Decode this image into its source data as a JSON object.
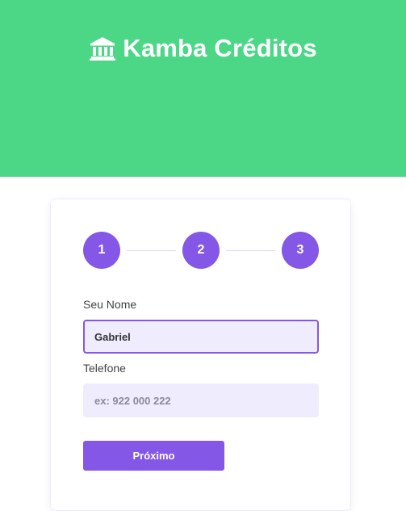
{
  "header": {
    "title": "Kamba Créditos",
    "icon": "bank-icon",
    "background_color": "#4cd787"
  },
  "stepper": {
    "steps": [
      "1",
      "2",
      "3"
    ],
    "accent_color": "#8457e6"
  },
  "form": {
    "name_label": "Seu Nome",
    "name_value": "Gabriel",
    "phone_label": "Telefone",
    "phone_placeholder": "ex: 922 000 222",
    "next_button_label": "Próximo"
  }
}
